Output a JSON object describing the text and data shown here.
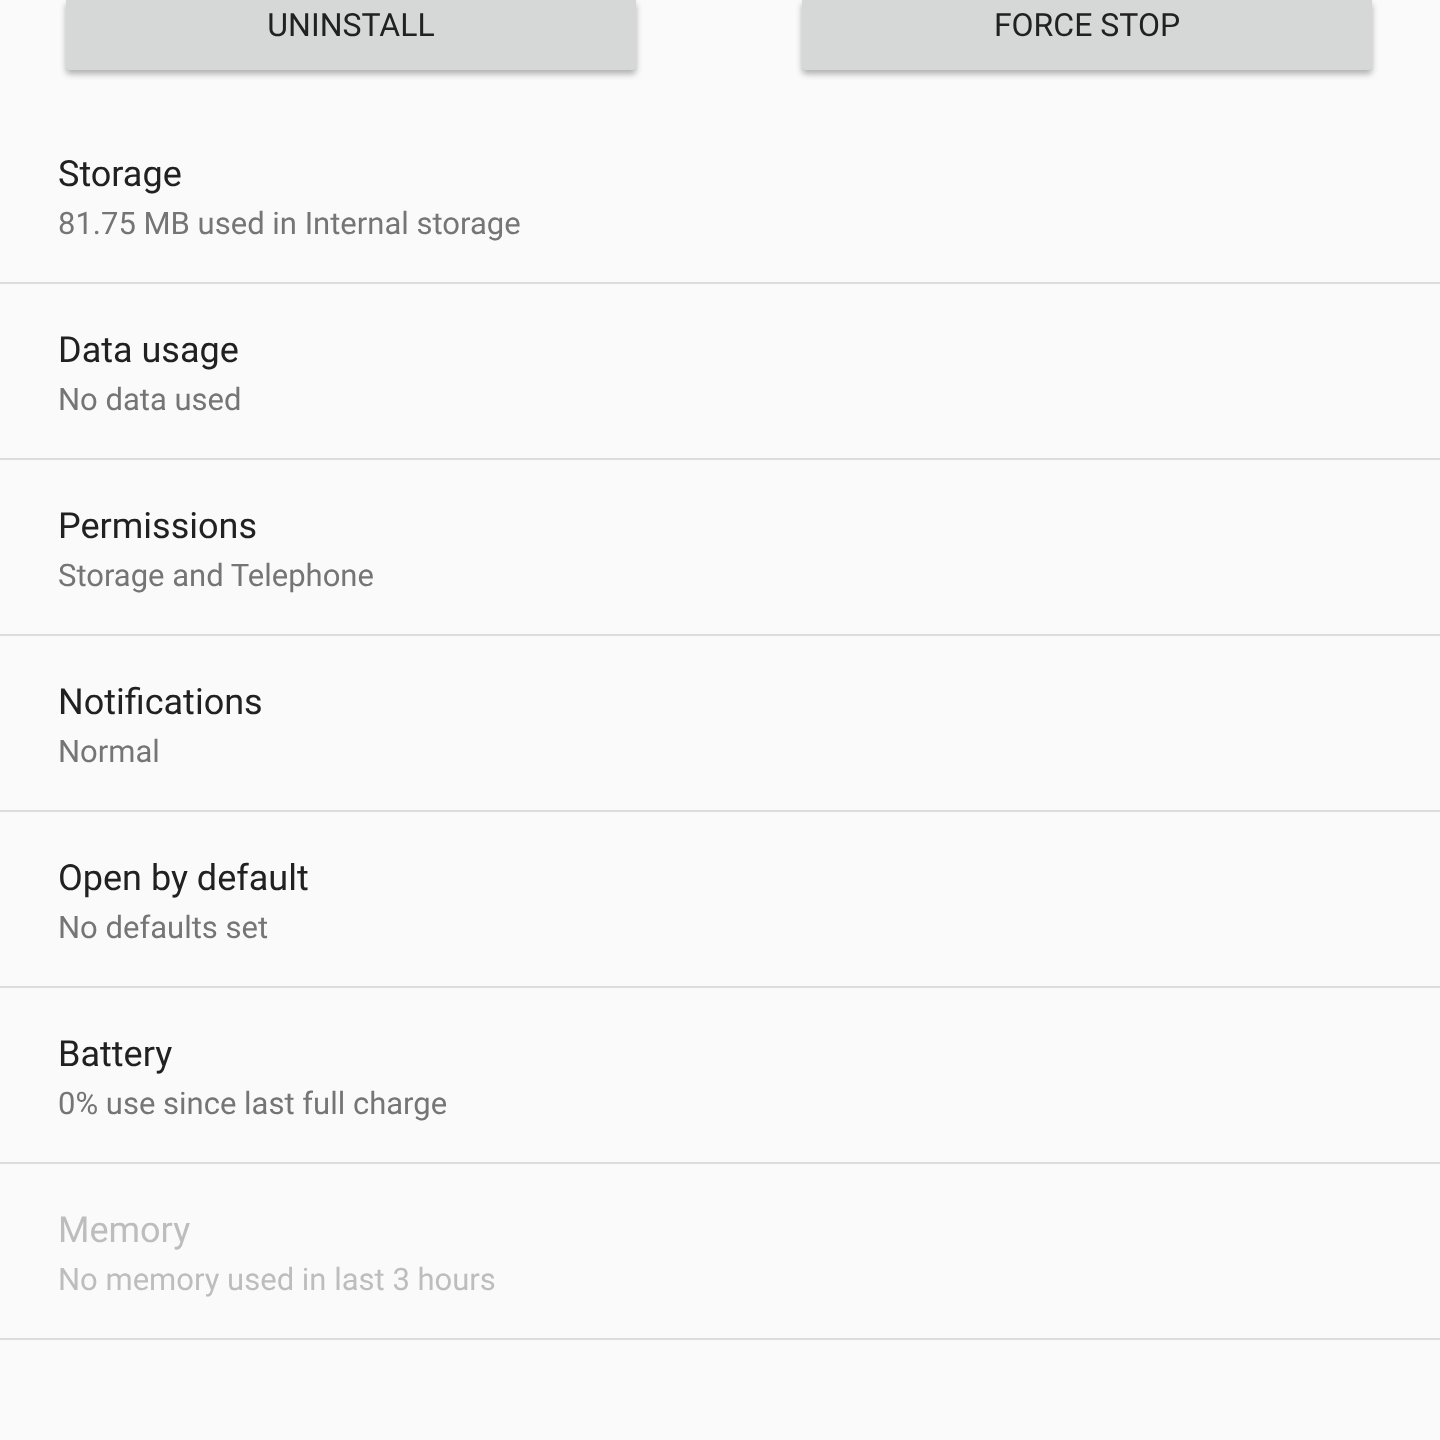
{
  "buttons": [
    {
      "label": "UNINSTALL"
    },
    {
      "label": "FORCE STOP"
    }
  ],
  "items": [
    {
      "title": "Storage",
      "summary": "81.75 MB used in Internal storage",
      "disabled": false
    },
    {
      "title": "Data usage",
      "summary": "No data used",
      "disabled": false
    },
    {
      "title": "Permissions",
      "summary": "Storage and Telephone",
      "disabled": false
    },
    {
      "title": "Notifications",
      "summary": "Normal",
      "disabled": false
    },
    {
      "title": "Open by default",
      "summary": "No defaults set",
      "disabled": false
    },
    {
      "title": "Battery",
      "summary": "0% use since last full charge",
      "disabled": false
    },
    {
      "title": "Memory",
      "summary": "No memory used in last 3 hours",
      "disabled": true
    }
  ]
}
